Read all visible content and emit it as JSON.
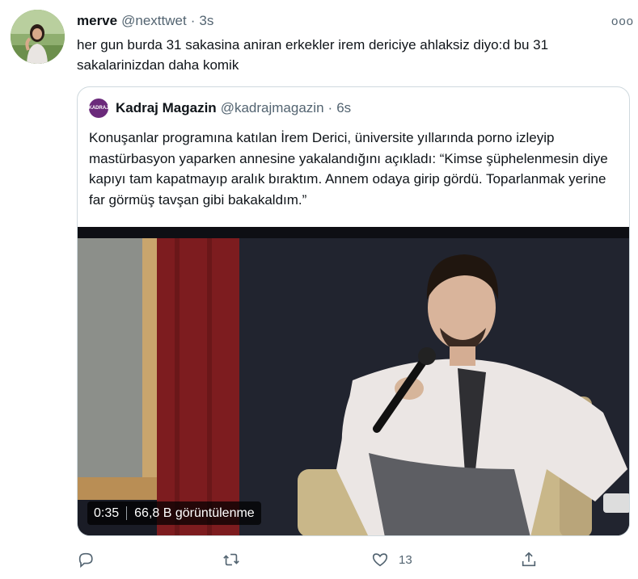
{
  "tweet": {
    "author_name": "merve",
    "author_handle": "@nexttwet",
    "separator": "·",
    "time": "3s",
    "more_label": "ooo",
    "text": "her gun burda 31 sakasina aniran erkekler irem dericiye ahlaksiz diyo:d bu 31 sakalarinizdan daha komik"
  },
  "quote": {
    "author_name": "Kadraj Magazin",
    "author_handle": "@kadrajmagazin",
    "separator": "·",
    "time": "6s",
    "avatar_text": "KADRAJ",
    "text": "Konuşanlar programına katılan İrem Derici, üniversite yıllarında porno izleyip mastürbasyon yaparken annesine yakalandığını açıkladı: “Kimse şüphelenmesin diye kapıyı tam kapatmayıp aralık bıraktım. Annem odaya girip gördü. Toparlanmak yerine far görmüş tavşan gibi bakakaldım.”",
    "video": {
      "duration": "0:35",
      "views": "66,8 B görüntülenme"
    }
  },
  "actions": {
    "reply_icon": "reply-icon",
    "retweet_icon": "retweet-icon",
    "like_icon": "heart-icon",
    "like_count": "13",
    "share_icon": "share-icon"
  },
  "colors": {
    "text": "#0f1419",
    "secondary": "#536471",
    "border": "#cfd9de",
    "brand_avatar": "#6b2a7b"
  }
}
